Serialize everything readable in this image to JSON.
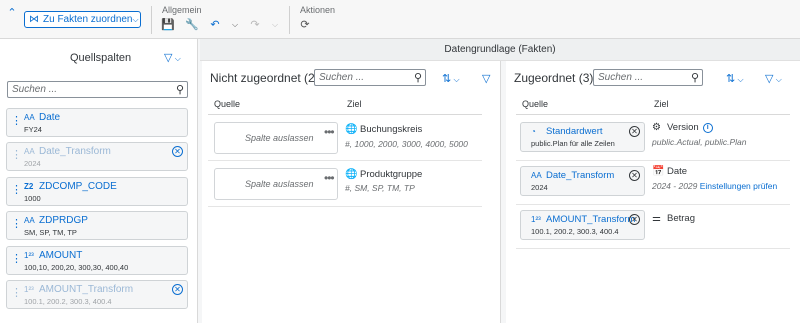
{
  "toolbar": {
    "assign_label": "Zu Fakten zuordnen",
    "group_general": "Allgemein",
    "group_actions": "Aktionen",
    "icons": [
      "collapse-icon",
      "save-icon",
      "wrench-icon",
      "undo-icon",
      "redo-icon",
      "reset-icon"
    ]
  },
  "strip": {
    "title": "Datengrundlage (Fakten)"
  },
  "source": {
    "title": "Quellspalten",
    "search_placeholder": "Suchen ...",
    "cards": [
      {
        "type": "AA",
        "name": "Date",
        "sample": "FY24",
        "faded": false
      },
      {
        "type": "AA",
        "name": "Date_Transform",
        "sample": "2024",
        "faded": true
      },
      {
        "type": "Z2",
        "name": "ZDCOMP_CODE",
        "sample": "1000",
        "faded": false
      },
      {
        "type": "AA",
        "name": "ZDPRDGP",
        "sample": "SM, SP, TM, TP",
        "faded": false
      },
      {
        "type": "1²³",
        "name": "AMOUNT",
        "sample": "100,10, 200,20, 300,30, 400,40",
        "faded": false
      },
      {
        "type": "1²³",
        "name": "AMOUNT_Transform",
        "sample": "100.1, 200.2, 300.3, 400.4",
        "faded": true
      }
    ]
  },
  "unassigned": {
    "title": "Nicht zugeordnet (2)",
    "search_placeholder": "Suchen ...",
    "col_source": "Quelle",
    "col_target": "Ziel",
    "rows": [
      {
        "placeholder": "Spalte auslassen",
        "target": "Buchungskreis",
        "sub": "#, 1000, 2000, 3000, 4000, 5000"
      },
      {
        "placeholder": "Spalte auslassen",
        "target": "Produktgruppe",
        "sub": "#, SM, SP, TM, TP"
      }
    ]
  },
  "assigned": {
    "title": "Zugeordnet (3)",
    "search_placeholder": "Suchen ...",
    "col_source": "Quelle",
    "col_target": "Ziel",
    "rows": [
      {
        "chip_type": "◔",
        "chip_name": "Standardwert",
        "chip_sample": "public.Plan für alle Zeilen",
        "target": "Version",
        "sub": "public.Actual, public.Plan",
        "link": ""
      },
      {
        "chip_type": "AA",
        "chip_name": "Date_Transform",
        "chip_sample": "2024",
        "target": "Date",
        "sub": "2024 - 2029",
        "link": "Einstellungen prüfen"
      },
      {
        "chip_type": "1²³",
        "chip_name": "AMOUNT_Transform",
        "chip_sample": "100.1, 200.2, 300.3, 400.4",
        "target": "Betrag",
        "sub": "",
        "link": ""
      }
    ]
  }
}
